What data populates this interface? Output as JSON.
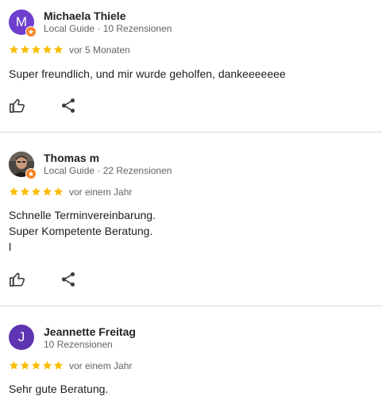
{
  "colors": {
    "star": "#fbbc04",
    "avatar_m": "#6e3fcf",
    "avatar_j": "#5e35b1",
    "guide_badge": "#f5821f",
    "icon": "#3c4043"
  },
  "reviews": [
    {
      "avatar_letter": "M",
      "avatar_type": "letter",
      "has_local_guide_badge": true,
      "name": "Michaela Thiele",
      "meta": "Local Guide · 10 Rezensionen",
      "rating": 5,
      "time": "vor 5 Monaten",
      "lines": [
        "Super freundlich, und mir wurde geholfen, dankeeeeeee"
      ],
      "actions": [
        "thumbs-up-icon",
        "share-icon"
      ]
    },
    {
      "avatar_type": "photo",
      "has_local_guide_badge": true,
      "name": "Thomas m",
      "meta": "Local Guide · 22 Rezensionen",
      "rating": 5,
      "time": "vor einem Jahr",
      "lines": [
        "Schnelle Terminvereinbarung.",
        "Super Kompetente Beratung.",
        "l"
      ],
      "actions": [
        "thumbs-up-icon",
        "share-icon"
      ]
    },
    {
      "avatar_letter": "J",
      "avatar_type": "letter",
      "has_local_guide_badge": false,
      "name": "Jeannette Freitag",
      "meta": "10 Rezensionen",
      "rating": 5,
      "time": "vor einem Jahr",
      "lines": [
        "Sehr gute Beratung."
      ]
    }
  ]
}
